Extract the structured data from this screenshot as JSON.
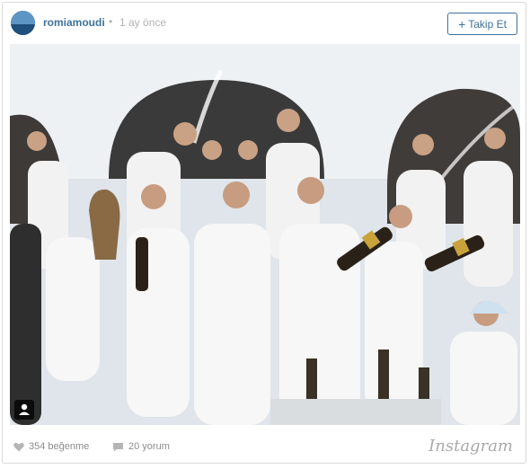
{
  "post": {
    "username": "romiamoudi",
    "separator": "•",
    "time": "1 ay önce",
    "follow_label": "Takip Et",
    "follow_icon": "plus-icon",
    "photo": {
      "description_icon": "tagged-user-icon"
    },
    "likes": "354 beğenme",
    "like_icon": "heart-icon",
    "comments": "20 yorum",
    "comment_icon": "speech-bubble-icon",
    "brand": "Instagram"
  },
  "colors": {
    "link": "#3f729b",
    "muted": "#8c8c8c",
    "border": "#d9d9d9"
  }
}
